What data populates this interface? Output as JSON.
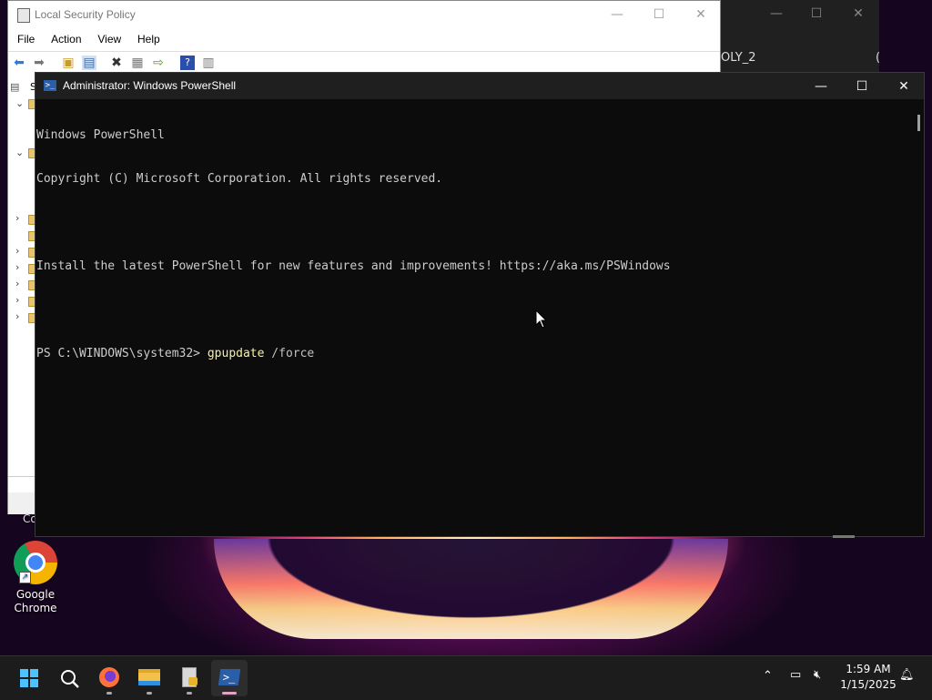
{
  "back_window": {
    "title_fragment": "OLY_2",
    "extra": "("
  },
  "lsp": {
    "title": "Local Security Policy",
    "menu": [
      "File",
      "Action",
      "View",
      "Help"
    ],
    "tree_label_fragment": "S",
    "status_fragment": "Co"
  },
  "powershell": {
    "title": "Administrator: Windows PowerShell",
    "lines": [
      "Windows PowerShell",
      "Copyright (C) Microsoft Corporation. All rights reserved.",
      "",
      "Install the latest PowerShell for new features and improvements! https://aka.ms/PSWindows",
      ""
    ],
    "prompt": "PS C:\\WINDOWS\\system32> ",
    "command": "gpupdate",
    "command_args": " /force"
  },
  "desktop_icons": [
    {
      "label_line1": "Google",
      "label_line2": "Chrome",
      "icon": "chrome-icon"
    }
  ],
  "taskbar": {
    "apps": [
      "start-icon",
      "search-icon",
      "firefox-icon",
      "file-explorer-icon",
      "security-policy-icon",
      "powershell-icon"
    ],
    "clock_time": "1:59 AM",
    "clock_date": "1/15/2025"
  },
  "colors": {
    "console_bg": "#0c0c0c",
    "console_text": "#cccccc",
    "command_color": "#f9f1a5",
    "accent": "#4cc2ff"
  }
}
